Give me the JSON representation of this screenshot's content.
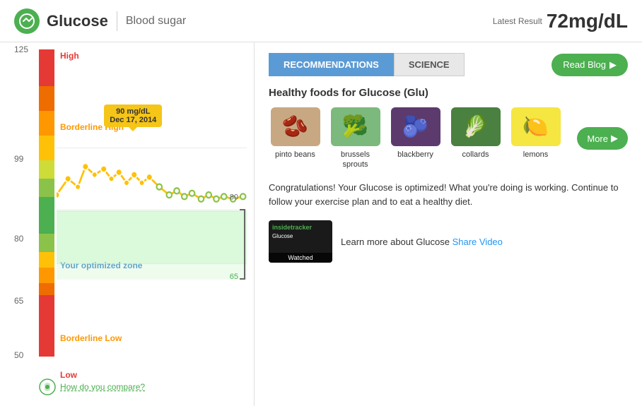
{
  "header": {
    "title": "Glucose",
    "subtitle": "Blood sugar",
    "latest_label": "Latest Result",
    "latest_value": "72mg/dL"
  },
  "chart": {
    "y_labels": [
      {
        "value": "125",
        "pct": 0
      },
      {
        "value": "99",
        "pct": 43
      },
      {
        "value": "80",
        "pct": 63
      },
      {
        "value": "65",
        "pct": 80
      },
      {
        "value": "50",
        "pct": 95
      }
    ],
    "zone_labels": [
      {
        "text": "High",
        "pct": 5,
        "color": "#e53935"
      },
      {
        "text": "Borderline High",
        "pct": 30,
        "color": "#ff9800"
      },
      {
        "text": "Your optimized zone",
        "pct": 70,
        "color": "#5b9bd5"
      },
      {
        "text": "Borderline Low",
        "pct": 88,
        "color": "#ff9800"
      },
      {
        "text": "Low",
        "pct": 96,
        "color": "#e53935"
      }
    ],
    "tooltip": {
      "line1": "90 mg/dL",
      "line2": "Dec 17, 2014"
    },
    "bracket_label_top": "80",
    "bracket_label_bottom": "65",
    "compare_link": "How do you compare?"
  },
  "tabs": [
    {
      "label": "RECOMMENDATIONS",
      "active": true
    },
    {
      "label": "SCIENCE",
      "active": false
    }
  ],
  "read_blog_btn": "Read Blog",
  "section_title": "Healthy foods for Glucose (Glu)",
  "foods": [
    {
      "name": "pinto beans",
      "emoji": "🫘"
    },
    {
      "name": "brussels sprouts",
      "emoji": "🥦"
    },
    {
      "name": "blackberry",
      "emoji": "🫐"
    },
    {
      "name": "collards",
      "emoji": "🥬"
    },
    {
      "name": "lemons",
      "emoji": "🍋"
    }
  ],
  "more_btn": "More",
  "congrats_text": "Congratulations! Your Glucose is optimized! What you're doing is working. Continue to follow your exercise plan and to eat a healthy diet.",
  "video": {
    "logo": "insidetracker",
    "title": "Glucose",
    "watched": "Watched",
    "desc": "Learn more about Glucose",
    "share_link": "Share Video"
  }
}
